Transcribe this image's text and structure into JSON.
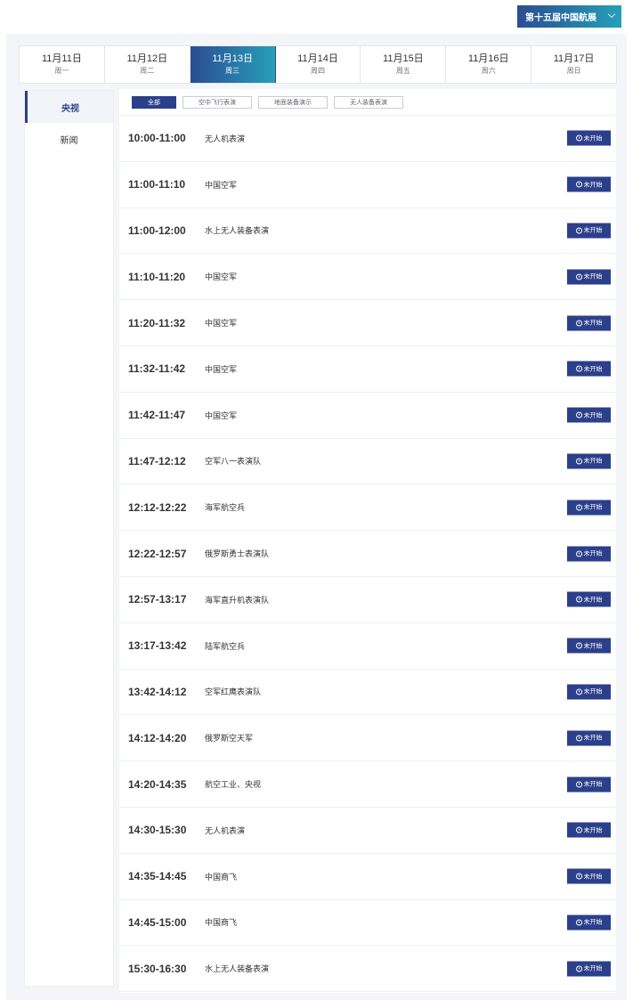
{
  "header": {
    "edition_label": "第十五届中国航展"
  },
  "dates": [
    {
      "date": "11月11日",
      "weekday": "周一"
    },
    {
      "date": "11月12日",
      "weekday": "周二"
    },
    {
      "date": "11月13日",
      "weekday": "周三"
    },
    {
      "date": "11月14日",
      "weekday": "周四"
    },
    {
      "date": "11月15日",
      "weekday": "周五"
    },
    {
      "date": "11月16日",
      "weekday": "周六"
    },
    {
      "date": "11月17日",
      "weekday": "周日"
    }
  ],
  "sidebar": {
    "items": [
      {
        "label": "央视"
      },
      {
        "label": "新闻"
      }
    ]
  },
  "filters": [
    {
      "label": "全部"
    },
    {
      "label": "空中飞行表演"
    },
    {
      "label": "地面装备演示"
    },
    {
      "label": "无人装备表演"
    }
  ],
  "schedule": [
    {
      "time": "10:00-11:00",
      "title": "无人机表演",
      "status": "未开始"
    },
    {
      "time": "11:00-11:10",
      "title": "中国空军",
      "status": "未开始"
    },
    {
      "time": "11:00-12:00",
      "title": "水上无人装备表演",
      "status": "未开始"
    },
    {
      "time": "11:10-11:20",
      "title": "中国空军",
      "status": "未开始"
    },
    {
      "time": "11:20-11:32",
      "title": "中国空军",
      "status": "未开始"
    },
    {
      "time": "11:32-11:42",
      "title": "中国空军",
      "status": "未开始"
    },
    {
      "time": "11:42-11:47",
      "title": "中国空军",
      "status": "未开始"
    },
    {
      "time": "11:47-12:12",
      "title": "空军八一表演队",
      "status": "未开始"
    },
    {
      "time": "12:12-12:22",
      "title": "海军航空兵",
      "status": "未开始"
    },
    {
      "time": "12:22-12:57",
      "title": "俄罗斯勇士表演队",
      "status": "未开始"
    },
    {
      "time": "12:57-13:17",
      "title": "海军直升机表演队",
      "status": "未开始"
    },
    {
      "time": "13:17-13:42",
      "title": "陆军航空兵",
      "status": "未开始"
    },
    {
      "time": "13:42-14:12",
      "title": "空军红鹰表演队",
      "status": "未开始"
    },
    {
      "time": "14:12-14:20",
      "title": "俄罗斯空天军",
      "status": "未开始"
    },
    {
      "time": "14:20-14:35",
      "title": "航空工业、央视",
      "status": "未开始"
    },
    {
      "time": "14:30-15:30",
      "title": "无人机表演",
      "status": "未开始"
    },
    {
      "time": "14:35-14:45",
      "title": "中国商飞",
      "status": "未开始"
    },
    {
      "time": "14:45-15:00",
      "title": "中国商飞",
      "status": "未开始"
    },
    {
      "time": "15:30-16:30",
      "title": "水上无人装备表演",
      "status": "未开始"
    }
  ]
}
